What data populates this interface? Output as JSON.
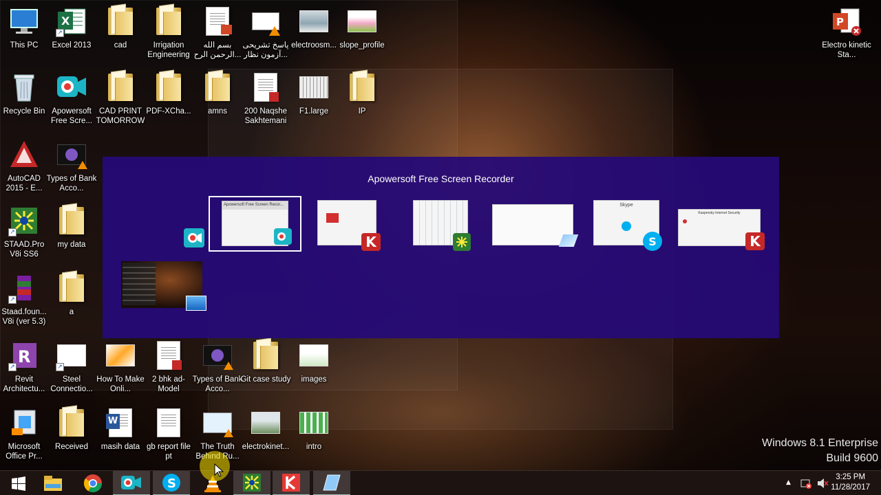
{
  "desktop": {
    "row1": [
      "This PC",
      "Excel 2013",
      "cad",
      "Irrigation Engineering",
      "بسم الله الرحمن الرح...",
      "پاسخ تشریحی آزمون نظار...",
      "electroosm...",
      "slope_profile"
    ],
    "row2": [
      "Recycle Bin",
      "Apowersoft Free Scre...",
      "CAD PRINT TOMORROW",
      "PDF-XCha...",
      "amns",
      "200 Naqshe Sakhtemani",
      "F1.large",
      "IP"
    ],
    "col1": [
      "AutoCAD 2015 - E...",
      "STAAD.Pro V8i SS6",
      "Staad.foun... V8i (ver 5.3)",
      "Revit Architectu...",
      "Microsoft Office Pr..."
    ],
    "col2": [
      "Types of Bank Acco...",
      "my data",
      "a",
      "Steel Connectio...",
      "Received"
    ],
    "row_bottom1": [
      "How To Make Onli...",
      "2 bhk ad-Model",
      "Types of Bank Acco...",
      "Git case study",
      "images"
    ],
    "row_bottom2": [
      "masih data",
      "gb report file pt",
      "The Truth Behind Ru...",
      "electrokinet...",
      "intro"
    ],
    "right_icon": "Electro kinetic Sta..."
  },
  "switcher": {
    "title": "Apowersoft Free Screen Recorder",
    "selected_window_title": "Apowersoft Free Screen Recor...",
    "skype_title": "Skype",
    "kaspersky_title": "Kaspersky Internet Security"
  },
  "watermark": {
    "line1": "Windows 8.1 Enterprise",
    "line2": "Build 9600"
  },
  "clock": {
    "time": "3:25 PM",
    "date": "11/28/2017"
  },
  "colors": {
    "switcher_bg": "#260a78",
    "taskbar_bg": "#1e1412"
  }
}
